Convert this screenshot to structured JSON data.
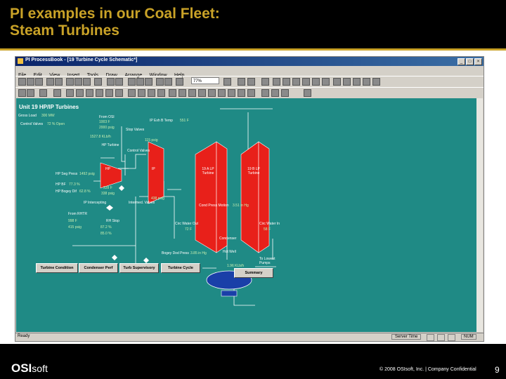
{
  "slide": {
    "title_line1": "PI examples in our Coal Fleet:",
    "title_line2": "Steam Turbines",
    "logo_main": "OSI",
    "logo_soft": "soft",
    "copyright": "© 2008 OSIsoft, Inc. | Company Confidential",
    "page_number": "9",
    "accent_color": "#c9a227"
  },
  "app": {
    "window_title": "PI ProcessBook - [19 Turbine Cycle Schematic*]",
    "menu": [
      "File",
      "Edit",
      "View",
      "Insert",
      "Tools",
      "Draw",
      "Arrange",
      "Window",
      "Help"
    ],
    "zoom": "77%",
    "status_ready": "Ready",
    "status_server_time": "Server Time",
    "status_num": "NUM",
    "canvas_color": "#1f8a85"
  },
  "schematic": {
    "title": "Unit 19 HP/IP Turbines",
    "labels": {
      "gross_load": "Gross Load",
      "control_valves": "Control Valves",
      "from_osi": "From OSI",
      "stop_valves": "Stop Valves",
      "ip_exh_temp": "IP Exh B Temp",
      "hp_turbine": "HP Turbine",
      "control_valves2": "Control Valves",
      "hp": "HP",
      "ip": "IP",
      "lp_a": "19 A LP Turbine",
      "lp_b": "19 B LP Turbine",
      "hp_seg": "HP Seg Press",
      "hp_bf": "HP BF",
      "hp_bogey": "HP Bogey Dif",
      "from_rhtr": "From RHTR",
      "rh_stop": "RH Stop",
      "ip_intercept": "IP Intercepting",
      "reheat_press": "Intermed. Valves",
      "circ_water_out": "Circ Water Out",
      "circ_water_in": "Circ Water In",
      "cond_press": "Cond Press Motion",
      "condenser": "Condenser",
      "hot_well": "Hot Well",
      "bogey": "Bogey Dod Press",
      "to_lowest": "To Lowest Pumps"
    },
    "values": {
      "gross_load": "300 MW",
      "control_valves": "72 % Open",
      "from_osi_f": "1003 F",
      "from_osi_psig": "2000 psig",
      "stop_lbs": "1527.8 KLb/h",
      "ip_exh_temp": "551 F",
      "ip_psig": "115 psig",
      "hp_seg": "1492 psig",
      "hp_bf": "77.3 %",
      "hp_bogey": "62.8 %",
      "hp_exh_f": "339 F",
      "hp_exh_psig": "338 psig",
      "rhtr_f": "998 F",
      "rhtr_psig": "415 psig",
      "rh_bf": "87.2 %",
      "rh_bogey": "85.0 %",
      "cond_press": "3.51 in Hg",
      "circ_out": "72 F",
      "circ_in": "58 F",
      "bogey": "3.85 in Hg",
      "ip_exh_psig": "438 psig",
      "lowest": "1.96 KLb/h"
    },
    "nav_buttons": [
      "Turbine Condition",
      "Condenser Perf",
      "Turb Supervisory",
      "Turbine Cycle"
    ],
    "summary_button": "Summary"
  }
}
